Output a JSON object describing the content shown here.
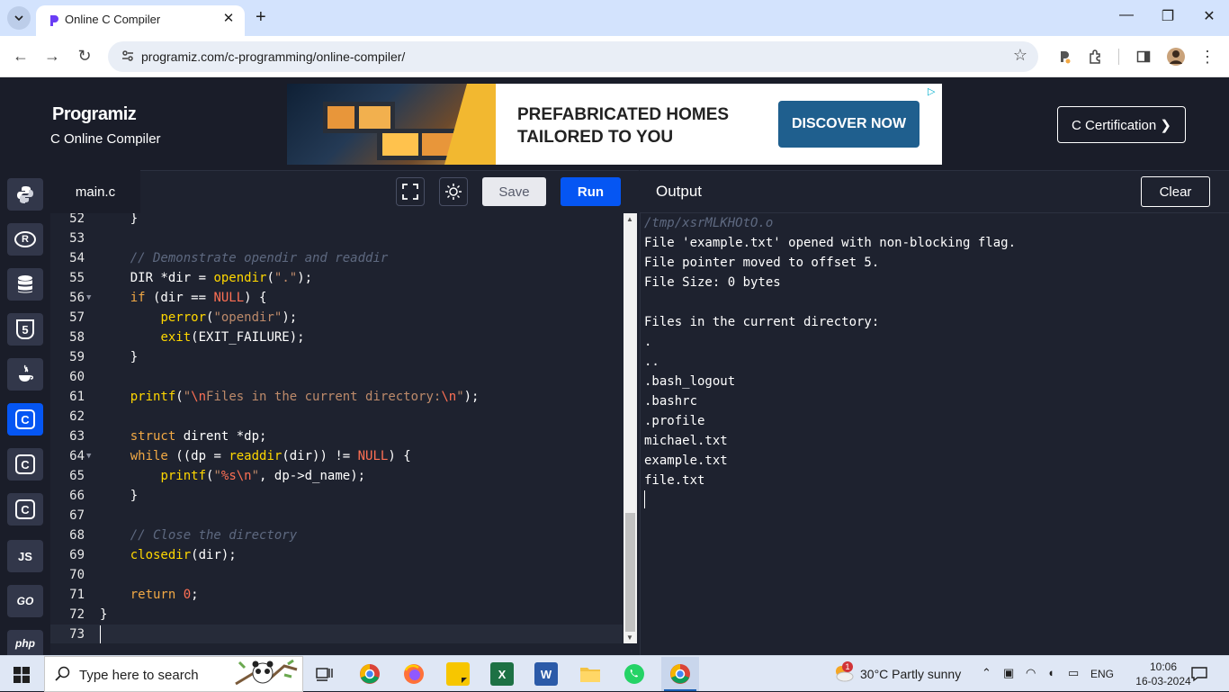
{
  "browser": {
    "tab_title": "Online C Compiler",
    "tab_close": "✕",
    "new_tab": "+",
    "url": "programiz.com/c-programming/online-compiler/"
  },
  "header": {
    "logo": "Programiz",
    "subtitle": "C Online Compiler",
    "ad_headline_1": "PREFABRICATED HOMES",
    "ad_headline_2": "TAILORED TO YOU",
    "ad_button": "DISCOVER NOW",
    "cert_button": "C Certification ❯"
  },
  "sidebar": {
    "languages": [
      {
        "icon": "python-icon",
        "label": ""
      },
      {
        "icon": "r-icon",
        "label": "R"
      },
      {
        "icon": "sql-icon",
        "label": ""
      },
      {
        "icon": "html-icon",
        "label": "5"
      },
      {
        "icon": "java-icon",
        "label": ""
      },
      {
        "icon": "c-icon",
        "label": "C"
      },
      {
        "icon": "cpp-icon",
        "label": "C"
      },
      {
        "icon": "csharp-icon",
        "label": "C"
      },
      {
        "icon": "js-icon",
        "label": "JS"
      },
      {
        "icon": "go-icon",
        "label": "GO"
      },
      {
        "icon": "php-icon",
        "label": "php"
      }
    ]
  },
  "editor": {
    "file_name": "main.c",
    "save_label": "Save",
    "run_label": "Run",
    "line_numbers": [
      "52",
      "53",
      "54",
      "55",
      "56",
      "57",
      "58",
      "59",
      "60",
      "61",
      "62",
      "63",
      "64",
      "65",
      "66",
      "67",
      "68",
      "69",
      "70",
      "71",
      "72",
      "73"
    ]
  },
  "output": {
    "title": "Output",
    "clear_label": "Clear",
    "lines": [
      "/tmp/xsrMLKHOtO.o",
      "File 'example.txt' opened with non-blocking flag.",
      "File pointer moved to offset 5.",
      "File Size: 0 bytes",
      "",
      "Files in the current directory:",
      ".",
      "..",
      ".bash_logout",
      ".bashrc",
      ".profile",
      "michael.txt",
      "example.txt",
      "file.txt"
    ]
  },
  "taskbar": {
    "search_placeholder": "Type here to search",
    "weather": "30°C  Partly sunny",
    "lang": "ENG",
    "time": "10:06",
    "date": "16-03-2024",
    "notification_count": "1"
  },
  "colors": {
    "accent": "#0556f3",
    "editor_bg": "#1e222f",
    "keyword": "#f2a945",
    "function": "#ffd700",
    "string": "#bd8a6a",
    "comment": "#5e6980",
    "null": "#ff7054"
  }
}
